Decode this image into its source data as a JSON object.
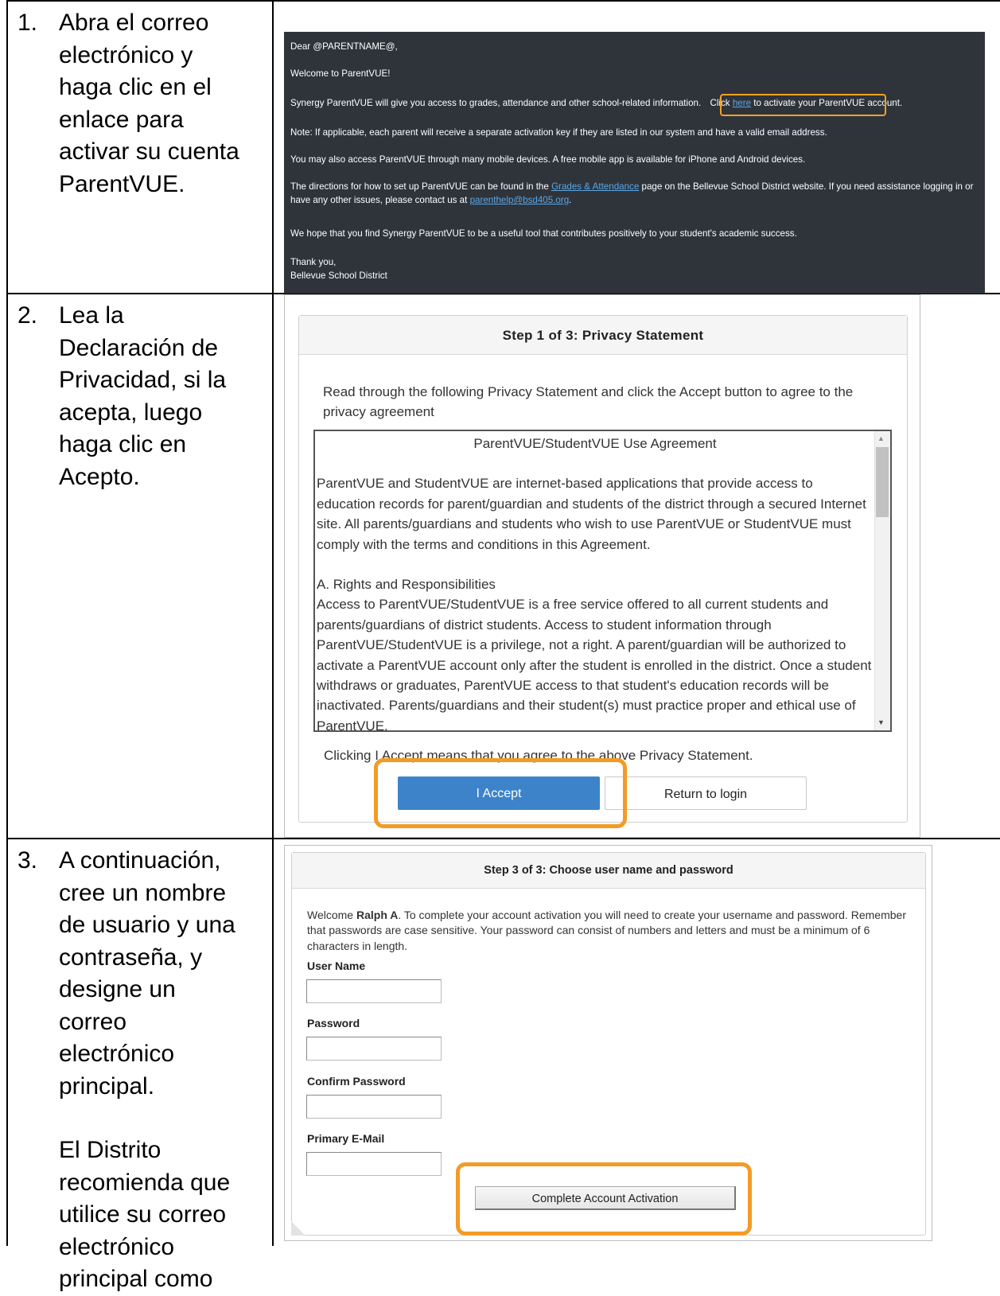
{
  "steps": [
    {
      "number": "1.",
      "lines": [
        "Abra el correo",
        "electrónico y",
        "haga clic en el",
        "enlace para",
        "activar su cuenta",
        "ParentVUE."
      ]
    },
    {
      "number": "2.",
      "lines": [
        "Lea la",
        "Declaración de",
        "Privacidad, si la",
        "acepta, luego",
        "haga clic en",
        "Acepto."
      ]
    },
    {
      "number": "3.",
      "lines": [
        "A continuación,",
        "cree un nombre",
        "de usuario y una",
        "contraseña, y",
        "designe un",
        "correo",
        "electrónico",
        "principal."
      ],
      "extra_lines": [
        "El Distrito",
        "recomienda que",
        "utilice su correo",
        "electrónico",
        "principal como"
      ]
    }
  ],
  "email": {
    "greeting": "Dear @PARENTNAME@,",
    "welcome": "Welcome to ParentVUE!",
    "access_text": "Synergy ParentVUE will give you access to grades, attendance and other school-related information.",
    "click_prefix": "Click",
    "link_here": "here",
    "click_suffix": "to activate your ParentVUE account.",
    "note": "Note: If applicable, each parent will receive a separate activation key if they are listed in our system and have a valid email address.",
    "mobile": "You may also access ParentVUE through many mobile devices.  A free mobile app is available for iPhone and Android devices.",
    "directions_prefix": "The directions for how to set up ParentVUE can be found in the",
    "link_grades": "Grades & Attendance",
    "directions_suffix": "page on the Bellevue School District website.  If you need assistance logging in or have any other issues, please contact us at",
    "link_email": "parenthelp@bsd405.org",
    "directions_end": ".",
    "hope": "We hope that you find Synergy ParentVUE to be a useful tool that contributes positively to your student's academic success.",
    "thanks": "Thank you,",
    "signature": "Bellevue School District"
  },
  "privacy": {
    "header": "Step 1 of 3: Privacy Statement",
    "intro": "Read through the following Privacy Statement and click the Accept button to agree to the privacy agreement",
    "agreement_title": "ParentVUE/StudentVUE Use Agreement",
    "paragraph1": "ParentVUE and StudentVUE are internet-based applications that provide access to education records for parent/guardian and students of the district through a secured Internet site. All parents/guardians and students who wish to use ParentVUE or StudentVUE must comply with the terms and conditions in this Agreement.",
    "section_a": "A. Rights and Responsibilities",
    "paragraph2": "Access to ParentVUE/StudentVUE is a free service offered to all current students and parents/guardians of district students. Access to student information through ParentVUE/StudentVUE is a privilege, not a right. A parent/guardian will be authorized to activate a ParentVUE account only after the student is enrolled in the district. Once a student withdraws or graduates, ParentVUE access to that student's education records will be inactivated. Parents/guardians and their student(s) must practice proper and ethical use of ParentVUE.",
    "clicking": "Clicking I Accept means that you agree to the above Privacy Statement.",
    "accept_button": "I Accept",
    "return_button": "Return to login"
  },
  "account": {
    "header": "Step 3 of 3: Choose user name and password",
    "welcome_prefix": "Welcome",
    "user_name_display": "Ralph A",
    "welcome_text": ". To complete your account activation you will need to create your username and password. Remember that passwords are case sensitive. Your password can consist of numbers and letters and must be a minimum of 6 characters in length.",
    "label_username": "User Name",
    "label_password": "Password",
    "label_confirm": "Confirm Password",
    "label_email": "Primary E-Mail",
    "complete_button": "Complete Account Activation"
  },
  "colors": {
    "highlight": "#f39b25",
    "email_bg": "#2f343b",
    "link": "#5aa7e6",
    "accept_button": "#3c83c9"
  }
}
